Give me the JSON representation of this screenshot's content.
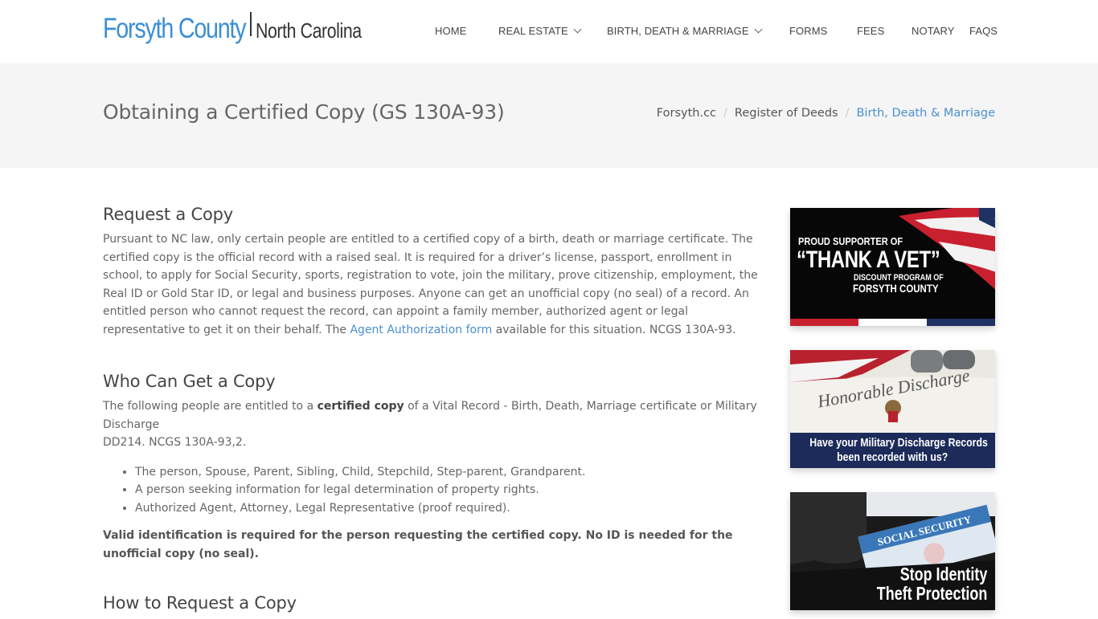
{
  "header": {
    "logo": {
      "main": "Forsyth County",
      "sub": "North Carolina",
      "color": "#3b8fd4"
    },
    "nav": [
      {
        "label": "HOME",
        "has_dropdown": false
      },
      {
        "label": "REAL ESTATE",
        "has_dropdown": true
      },
      {
        "label": "BIRTH, DEATH & MARRIAGE",
        "has_dropdown": true
      },
      {
        "label": "FORMS",
        "has_dropdown": false
      },
      {
        "label": "FEES",
        "has_dropdown": false
      },
      {
        "label": "NOTARY",
        "has_dropdown": false
      },
      {
        "label": "FAQS",
        "has_dropdown": false
      }
    ]
  },
  "title_band": {
    "title": "Obtaining a Certified Copy (GS 130A-93)",
    "breadcrumb": [
      {
        "label": "Forsyth.cc"
      },
      {
        "label": "Register of Deeds"
      },
      {
        "label": "Birth, Death & Marriage",
        "active": true
      }
    ],
    "separator": "/"
  },
  "main": {
    "sections": [
      {
        "heading": "Request a Copy",
        "text_before_link": "Pursuant to NC law, only certain people are entitled to a certified copy of a birth, death or marriage certificate. The certified copy is the official record with a raised seal. It is required for a driver’s license, passport, enrollment in school, to apply for Social Security, sports, registration to vote, join the military, prove citizenship, employment, the Real ID or Gold Star ID, or legal and business purposes. Anyone can get an unofficial copy (no seal) of a record. An entitled person who cannot request the record, can appoint a family member, authorized agent or legal representative to get it on their behalf. The ",
        "link": "Agent Authorization form",
        "text_after_link": " available for this situation. NCGS 130A-93."
      },
      {
        "heading": "Who Can Get a Copy",
        "intro_before_bold": "The following people are entitled to a ",
        "intro_bold": "certified copy",
        "intro_after_bold": " of a Vital Record - Birth, Death, Marriage certificate or Military Discharge",
        "intro_line2": "DD214. NCGS 130A-93,2.",
        "bullets": [
          "The person, Spouse, Parent, Sibling, Child, Stepchild, Step-parent, Grandparent.",
          "A person seeking information for legal determination of property rights.",
          "Authorized Agent, Attorney, Legal Representative (proof required)."
        ],
        "note": "Valid identification is required for the person requesting the certified copy. No ID is needed for the unofficial copy (no seal)."
      },
      {
        "heading": "How to Request a Copy"
      }
    ]
  },
  "sidebar": {
    "banners": [
      {
        "name": "thank-a-vet",
        "line1": "PROUD SUPPORTER OF",
        "line2": "“THANK A VET”",
        "line3": "DISCOUNT PROGRAM OF",
        "line4": "FORSYTH COUNTY",
        "stripe_colors": [
          "#c8202f",
          "#ffffff",
          "#1e3263"
        ]
      },
      {
        "name": "military-discharge",
        "scene_text": "Honorable Discharge",
        "caption_line1": "Have your Military Discharge Records",
        "caption_line2": "been recorded with us?"
      },
      {
        "name": "identity-theft",
        "card_text": "SOCIAL SECURITY",
        "caption_line1": "Stop Identity",
        "caption_line2": "Theft Protection"
      }
    ]
  }
}
